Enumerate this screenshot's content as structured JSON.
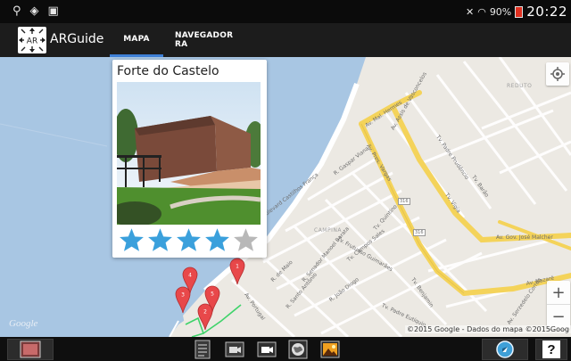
{
  "status_bar": {
    "battery_text": "90%",
    "time": "20:22"
  },
  "action_bar": {
    "app_name": "ARGuide",
    "logo_text": "AR",
    "tabs": [
      {
        "label": "MAPA",
        "active": true
      },
      {
        "label": "NAVEGADOR RA",
        "active": false
      }
    ],
    "accent_color": "#3d7fd6"
  },
  "map": {
    "info_window": {
      "title": "Forte do Castelo",
      "rating": 4,
      "max_rating": 5,
      "star_color": "#3aa0dc",
      "star_empty_color": "#b8b8b8"
    },
    "district_label": "CAMPINA",
    "top_right_label": "REDUTO",
    "road_shields": [
      "316",
      "316"
    ],
    "street_labels": [
      "Av. Mal. Hermes",
      "Av. Assis de Vasconcelos",
      "Tv. Padre Prudêncio",
      "Av. Pres. Vargas",
      "R. Gaspar Viana",
      "Tv. Frutuoso Guimarães",
      "R. Senador Manoel Barata",
      "Tv. Campos Sales",
      "R. João Diogo",
      "Tv. Padre Eutíquio",
      "Av. Gov. José Malcher",
      "Av. Nazaré",
      "Av. Serzedelo Corrêa",
      "Av. Portugal",
      "R. Santo Antônio",
      "R. de Maio",
      "Tv. Benjamin",
      "Tv. Quintino",
      "Boulevard Castilhos França",
      "Tv. Vigia",
      "Tv. Barão"
    ],
    "markers": [
      "1",
      "2",
      "3",
      "4",
      "5"
    ],
    "google_logo": "Google",
    "copyright": "©2015 Google - Dados do mapa ©2015Goog",
    "zoom_in": "+",
    "zoom_out": "−"
  },
  "bottom_bar": {
    "icons": [
      "gallery-icon",
      "list-icon",
      "camera-icon",
      "video-icon",
      "globe-icon",
      "image-icon",
      "compass-icon",
      "help-icon"
    ],
    "help_label": "?"
  }
}
